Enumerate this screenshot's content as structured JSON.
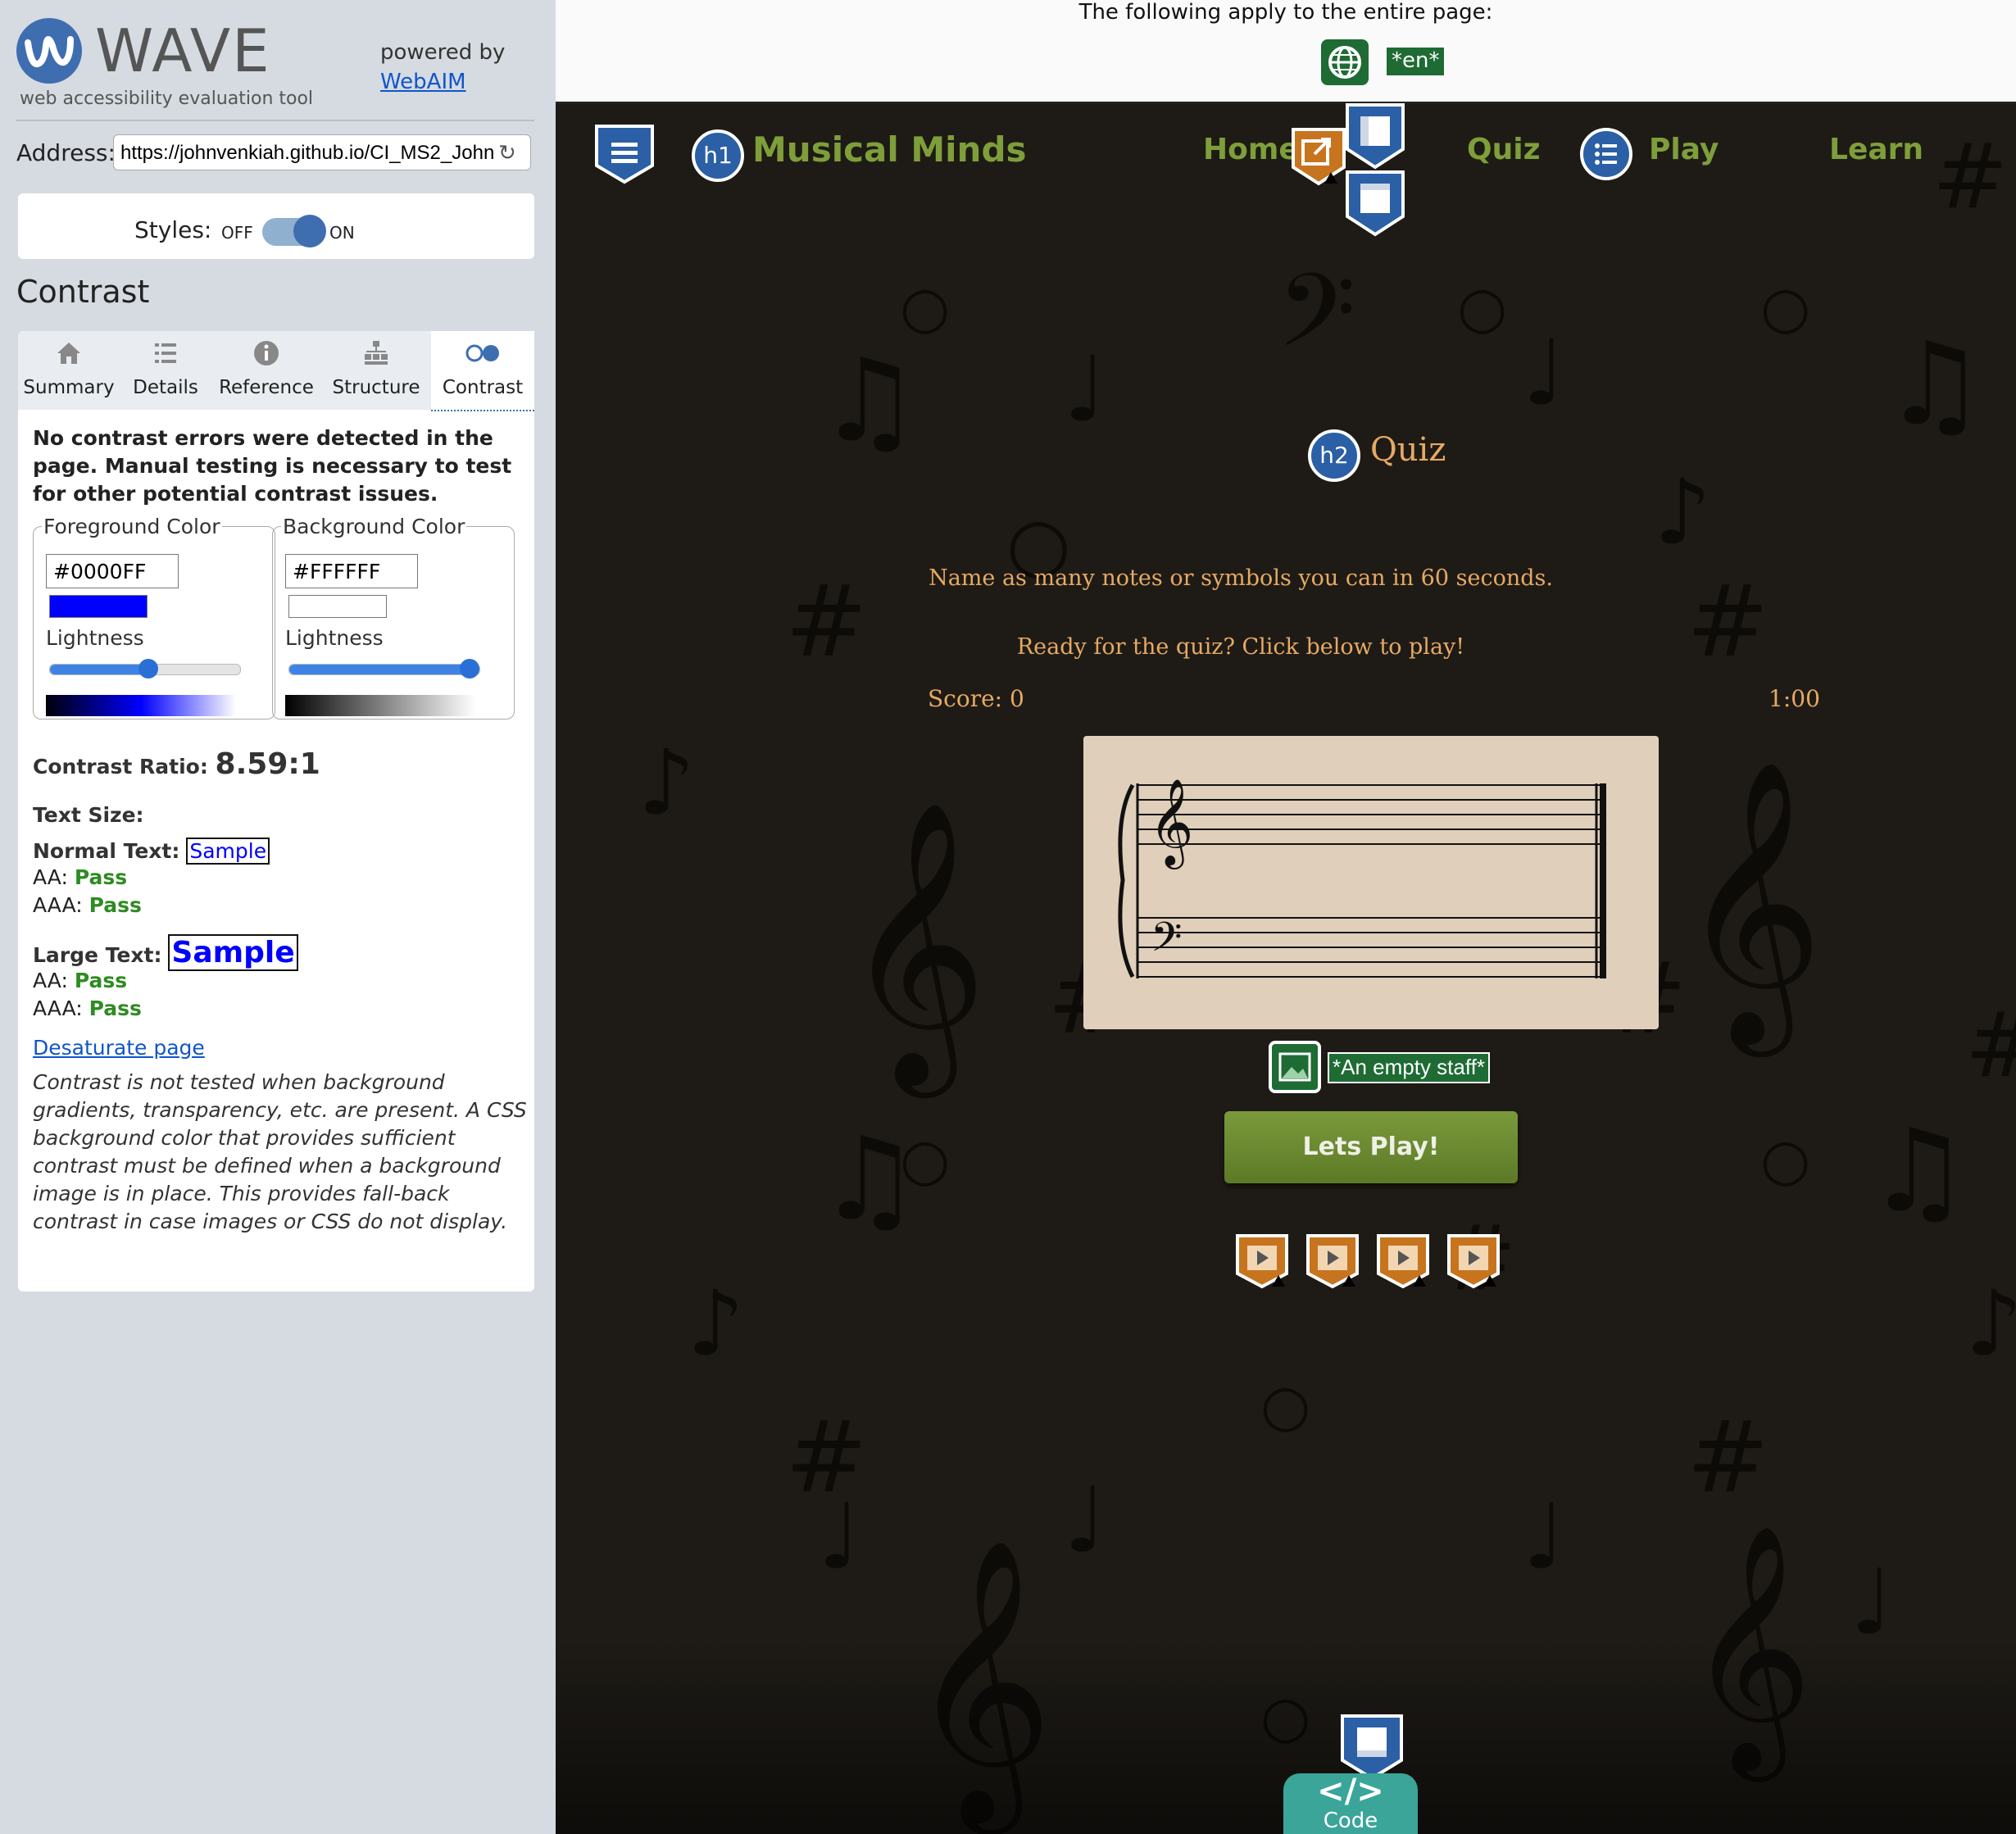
{
  "wave": {
    "logo_text": "WAVE",
    "logo_subtitle": "web accessibility evaluation tool",
    "powered_by": "powered by",
    "webaim_link": "WebAIM",
    "address_label": "Address:",
    "address_value": "https://johnvenkiah.github.io/CI_MS2_John",
    "styles_label": "Styles:",
    "styles_off": "OFF",
    "styles_on": "ON",
    "panel_heading": "Contrast",
    "tabs": [
      {
        "label": "Summary",
        "icon": "home-icon"
      },
      {
        "label": "Details",
        "icon": "list-icon"
      },
      {
        "label": "Reference",
        "icon": "info-icon"
      },
      {
        "label": "Structure",
        "icon": "structure-icon"
      },
      {
        "label": "Contrast",
        "icon": "contrast-icon",
        "active": true
      }
    ],
    "no_errors_text": "No contrast errors were detected in the page. Manual testing is necessary to test for other potential contrast issues.",
    "foreground": {
      "legend": "Foreground Color",
      "hex": "#0000FF",
      "lightness_label": "Lightness",
      "lightness_level": 0.5
    },
    "background": {
      "legend": "Background Color",
      "hex": "#FFFFFF",
      "lightness_label": "Lightness",
      "lightness_level": 0.95
    },
    "contrast_ratio_label": "Contrast Ratio:",
    "contrast_ratio_value": "8.59:1",
    "text_size_label": "Text Size:",
    "normal_text_label": "Normal Text:",
    "large_text_label": "Large Text:",
    "sample": "Sample",
    "aa_label": "AA:",
    "aaa_label": "AAA:",
    "pass": "Pass",
    "desaturate_link": "Desaturate page",
    "note": "Contrast is not tested when background gradients, transparency, etc. are present. A CSS background color that provides sufficient contrast must be defined when a background image is in place. This provides fall-back contrast in case images or CSS do not display."
  },
  "page": {
    "topbar_text": "The following apply to the entire page:",
    "lang_tag": "*en*",
    "h1_badge": "h1",
    "h2_badge": "h2",
    "brand": "Musical Minds",
    "nav": [
      "Home",
      "Quiz",
      "Play",
      "Learn"
    ],
    "section_title": "Quiz",
    "instruction": "Name as many notes or symbols you can in 60 seconds.",
    "ready_text": "Ready for the quiz? Click below to play!",
    "score_text": "Score: 0",
    "timer_text": "1:00",
    "alt_text": "*An empty staff*",
    "play_button": "Lets Play!",
    "code_symbol": "</>",
    "code_label": "Code"
  },
  "colors": {
    "wave_blue": "#3E6EB0",
    "pass_green": "#2E8B22",
    "nav_green": "#7E9E3A",
    "accent_orange": "#E6A964",
    "page_bg": "#1E1B16",
    "staff_bg": "#E0CFBA",
    "code_teal": "#3AA598",
    "icon_green": "#1E6B34"
  }
}
